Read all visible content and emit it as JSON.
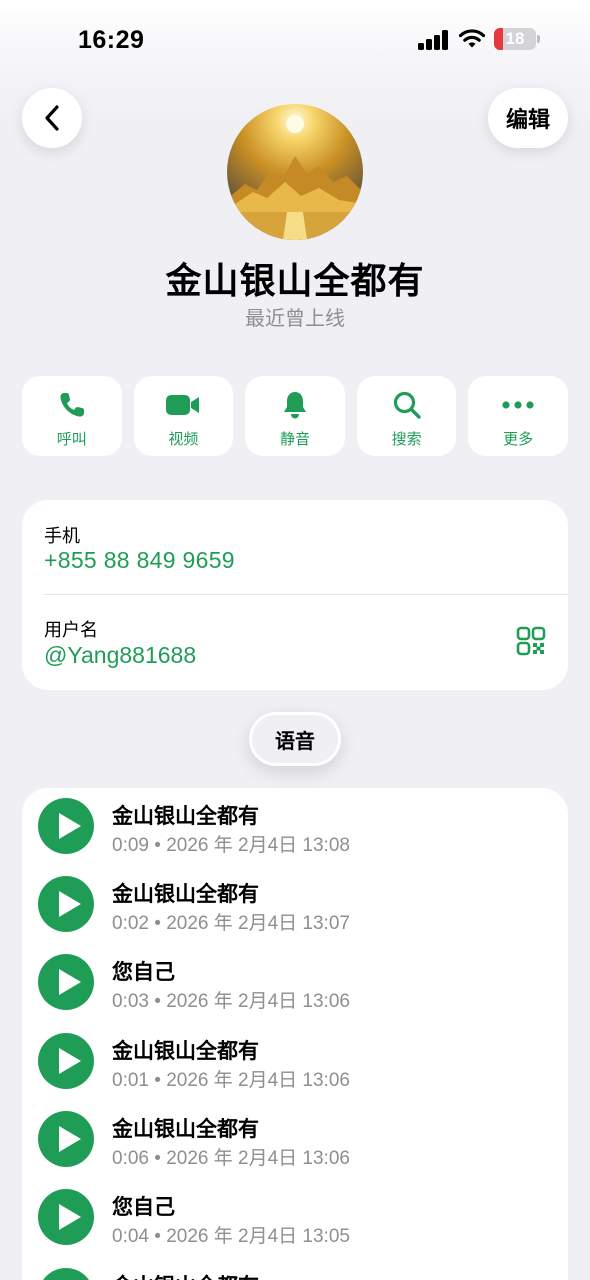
{
  "status_bar": {
    "time": "16:29",
    "battery": "18",
    "battery_color": "#e5393d"
  },
  "header": {
    "back_icon": "chevron-left-icon",
    "edit_label": "编辑"
  },
  "profile": {
    "name": "金山银山全都有",
    "status": "最近曾上线"
  },
  "actions": [
    {
      "icon": "phone-icon",
      "label": "呼叫"
    },
    {
      "icon": "video-icon",
      "label": "视频"
    },
    {
      "icon": "bell-icon",
      "label": "静音"
    },
    {
      "icon": "search-icon",
      "label": "搜索"
    },
    {
      "icon": "more-icon",
      "label": "更多"
    }
  ],
  "info": {
    "phone_label": "手机",
    "phone_value": "+855 88 849 9659",
    "username_label": "用户名",
    "username_value": "@Yang881688",
    "qr_icon": "qr-code-icon"
  },
  "media_filter": {
    "label": "语音"
  },
  "voice_messages": [
    {
      "sender": "金山银山全都有",
      "meta": "0:09 • 2026 年 2月4日 13:08"
    },
    {
      "sender": "金山银山全都有",
      "meta": "0:02 • 2026 年 2月4日 13:07"
    },
    {
      "sender": "您自己",
      "meta": "0:03 • 2026 年 2月4日 13:06"
    },
    {
      "sender": "金山银山全都有",
      "meta": "0:01 • 2026 年 2月4日 13:06"
    },
    {
      "sender": "金山银山全都有",
      "meta": "0:06 • 2026 年 2月4日 13:06"
    },
    {
      "sender": "您自己",
      "meta": "0:04 • 2026 年 2月4日 13:05"
    },
    {
      "sender": "金山银山全都有",
      "meta": ""
    }
  ],
  "colors": {
    "accent": "#1f9d57",
    "background": "#efeff4",
    "secondary_text": "#8e8e93"
  }
}
